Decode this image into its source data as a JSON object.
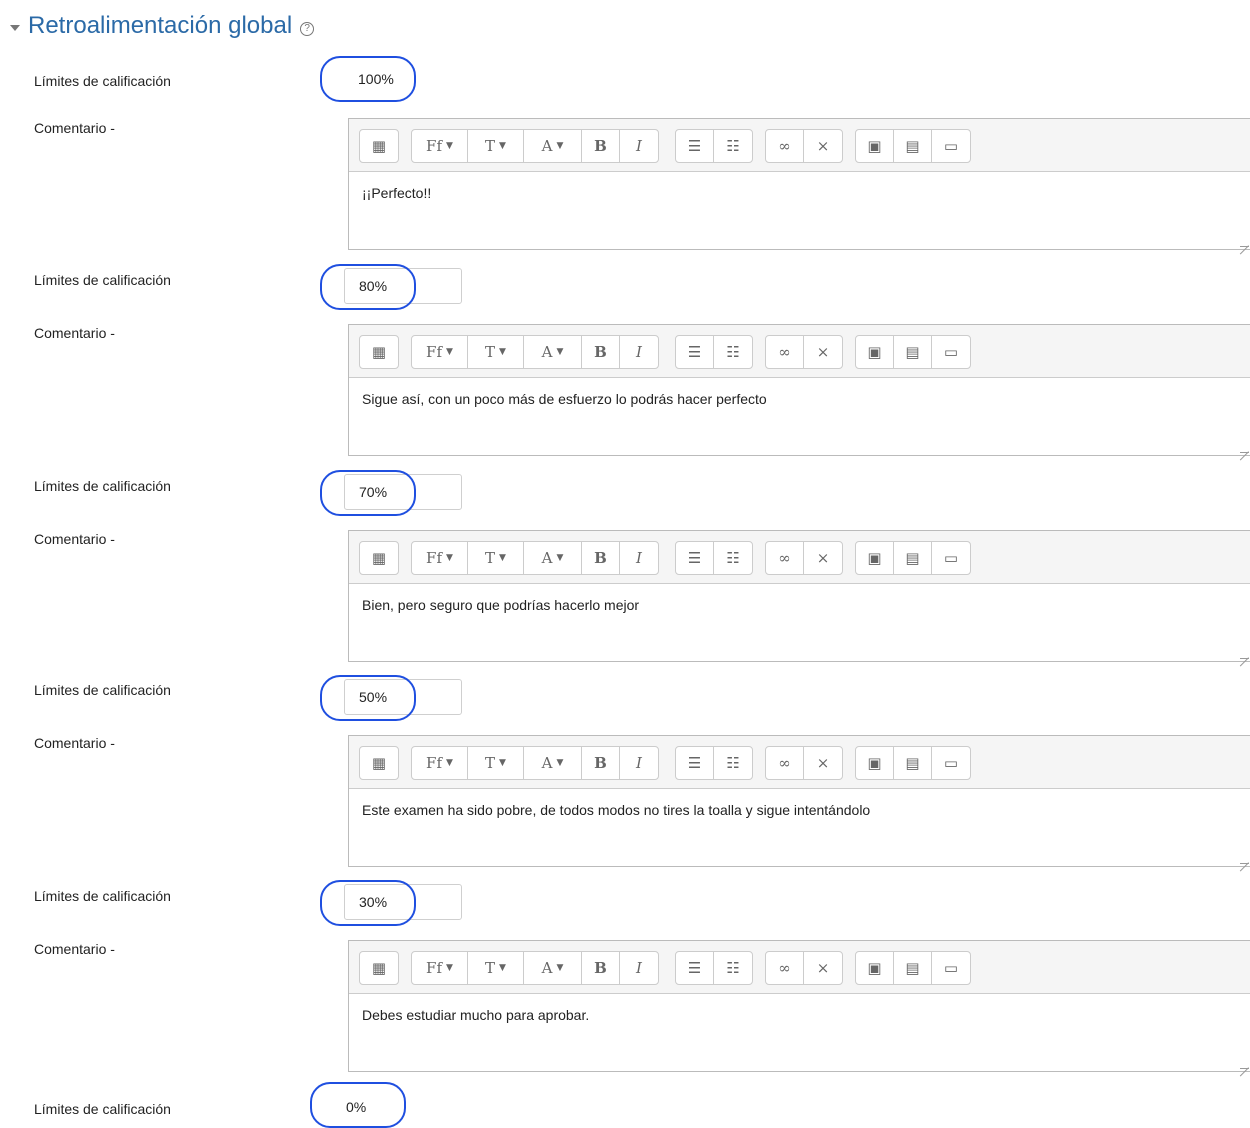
{
  "section": {
    "title": "Retroalimentación global",
    "help_icon": "question-circle-icon"
  },
  "labels": {
    "grade_boundary": "Límites de calificación",
    "comment": "Comentario -"
  },
  "highlight_color": "#1f4fe0",
  "toolbar_icons": [
    "toolbar-toggle-icon",
    "font-family-icon",
    "font-size-icon",
    "font-color-icon",
    "bold-icon",
    "italic-icon",
    "bullet-list-icon",
    "numbered-list-icon",
    "link-icon",
    "unlink-icon",
    "image-icon",
    "media-icon",
    "paste-icon"
  ],
  "feedback": [
    {
      "grade": "100%",
      "comment": "¡¡Perfecto!!"
    },
    {
      "grade": "80%",
      "comment": "Sigue así, con un poco más de esfuerzo lo podrás hacer perfecto"
    },
    {
      "grade": "70%",
      "comment": "Bien, pero seguro que podrías hacerlo mejor"
    },
    {
      "grade": "50%",
      "comment": "Este examen ha sido pobre, de todos modos no tires la toalla y sigue intentándolo"
    },
    {
      "grade": "30%",
      "comment": "Debes estudiar mucho para aprobar."
    }
  ],
  "final_boundary": {
    "grade": "0%"
  }
}
